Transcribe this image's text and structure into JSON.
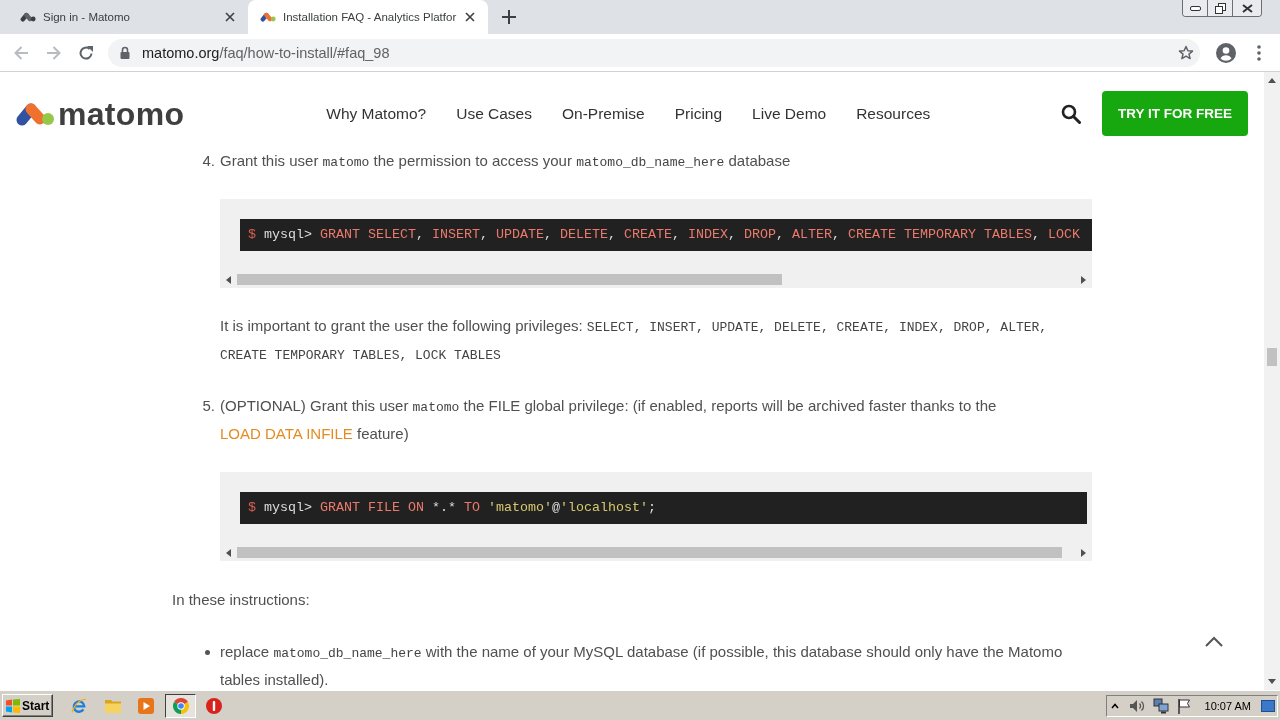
{
  "browser": {
    "tabs": [
      {
        "title": "Sign in - Matomo",
        "selected": false
      },
      {
        "title": "Installation FAQ - Analytics Platfor",
        "selected": true
      }
    ],
    "url": {
      "host": "matomo.org",
      "path": "/faq/how-to-install/#faq_98"
    }
  },
  "site_header": {
    "logo_text": "matomo",
    "nav": [
      "Why Matomo?",
      "Use Cases",
      "On-Premise",
      "Pricing",
      "Live Demo",
      "Resources"
    ],
    "cta": "TRY IT FOR FREE"
  },
  "instructions": {
    "steps": [
      {
        "number": "4.",
        "parts": [
          {
            "kind": "text",
            "text": "Grant this user "
          },
          {
            "kind": "code",
            "text": "matomo"
          },
          {
            "kind": "text",
            "text": " the permission to access your "
          },
          {
            "kind": "code",
            "text": "matomo_db_name_here"
          },
          {
            "kind": "text",
            "text": " database"
          }
        ],
        "blocks": [
          {
            "kind": "code",
            "tokens": [
              {
                "kind": "prompt",
                "text": "$"
              },
              {
                "kind": "plain",
                "text": " mysql> "
              },
              {
                "kind": "keyword",
                "text": "GRANT SELECT"
              },
              {
                "kind": "plain",
                "text": ", "
              },
              {
                "kind": "keyword",
                "text": "INSERT"
              },
              {
                "kind": "plain",
                "text": ", "
              },
              {
                "kind": "keyword",
                "text": "UPDATE"
              },
              {
                "kind": "plain",
                "text": ", "
              },
              {
                "kind": "keyword",
                "text": "DELETE"
              },
              {
                "kind": "plain",
                "text": ", "
              },
              {
                "kind": "keyword",
                "text": "CREATE"
              },
              {
                "kind": "plain",
                "text": ", "
              },
              {
                "kind": "keyword",
                "text": "INDEX"
              },
              {
                "kind": "plain",
                "text": ", "
              },
              {
                "kind": "keyword",
                "text": "DROP"
              },
              {
                "kind": "plain",
                "text": ", "
              },
              {
                "kind": "keyword",
                "text": "ALTER"
              },
              {
                "kind": "plain",
                "text": ", "
              },
              {
                "kind": "keyword",
                "text": "CREATE TEMPORARY TABLES"
              },
              {
                "kind": "plain",
                "text": ", "
              },
              {
                "kind": "keyword",
                "text": "LOCK"
              }
            ]
          },
          {
            "kind": "paragraph",
            "parts": [
              {
                "kind": "text",
                "text": "It is important to grant the user the following privileges: "
              },
              {
                "kind": "code",
                "text": "SELECT, INSERT, UPDATE, DELETE, CREATE, INDEX, DROP, ALTER, CREATE TEMPORARY TABLES, LOCK TABLES"
              }
            ]
          }
        ]
      },
      {
        "number": "5.",
        "parts": [
          {
            "kind": "text",
            "text": "(OPTIONAL) Grant this user "
          },
          {
            "kind": "code",
            "text": "matomo"
          },
          {
            "kind": "text",
            "text": " the FILE global privilege: (if enabled, reports will be archived faster thanks to the "
          },
          {
            "kind": "link",
            "text": "LOAD DATA INFILE"
          },
          {
            "kind": "text",
            "text": " feature)"
          }
        ],
        "blocks": [
          {
            "kind": "code",
            "tokens": [
              {
                "kind": "prompt",
                "text": "$"
              },
              {
                "kind": "plain",
                "text": " mysql> "
              },
              {
                "kind": "keyword",
                "text": "GRANT FILE ON"
              },
              {
                "kind": "plain",
                "text": " *.* "
              },
              {
                "kind": "keyword",
                "text": "TO"
              },
              {
                "kind": "string",
                "text": " 'matomo'"
              },
              {
                "kind": "plain",
                "text": "@"
              },
              {
                "kind": "string",
                "text": "'localhost'"
              },
              {
                "kind": "plain",
                "text": ";"
              }
            ]
          }
        ]
      }
    ],
    "intro": "In these instructions:",
    "bullets": [
      {
        "parts": [
          {
            "kind": "text",
            "text": "replace "
          },
          {
            "kind": "code",
            "text": "matomo_db_name_here"
          },
          {
            "kind": "text",
            "text": " with the name of your MySQL database (if possible, this database should only have the Matomo tables installed)."
          }
        ]
      }
    ]
  },
  "taskbar": {
    "start": "Start",
    "clock": "10:07 AM"
  }
}
